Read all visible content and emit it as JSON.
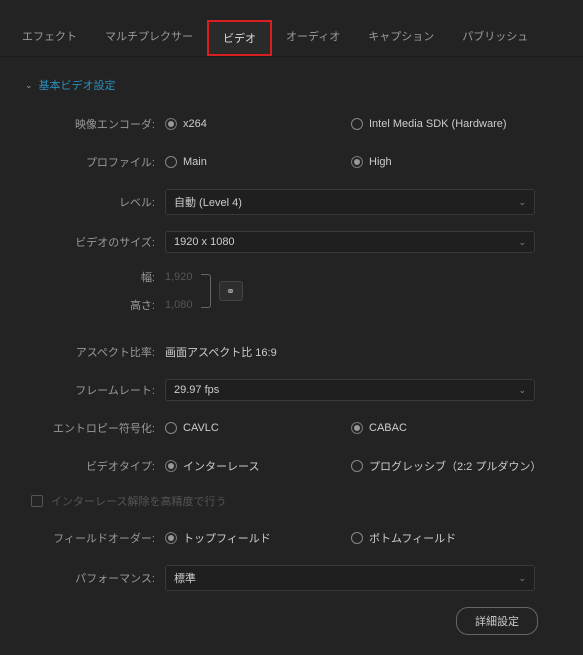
{
  "tabs": {
    "effect": "エフェクト",
    "multiplexer": "マルチプレクサー",
    "video": "ビデオ",
    "audio": "オーディオ",
    "caption": "キャプション",
    "publish": "パブリッシュ"
  },
  "section": {
    "title": "基本ビデオ設定"
  },
  "fields": {
    "encoder": {
      "label": "映像エンコーダ:",
      "opt1": "x264",
      "opt2": "Intel Media SDK (Hardware)"
    },
    "profile": {
      "label": "プロファイル:",
      "opt1": "Main",
      "opt2": "High"
    },
    "level": {
      "label": "レベル:",
      "value": "自動 (Level 4)"
    },
    "size": {
      "label": "ビデオのサイズ:",
      "value": "1920 x 1080"
    },
    "width": {
      "label": "幅:",
      "value": "1,920"
    },
    "height": {
      "label": "高さ:",
      "value": "1,080"
    },
    "aspect": {
      "label": "アスペクト比率:",
      "value": "画面アスペクト比 16:9"
    },
    "framerate": {
      "label": "フレームレート:",
      "value": "29.97 fps"
    },
    "entropy": {
      "label": "エントロピー符号化:",
      "opt1": "CAVLC",
      "opt2": "CABAC"
    },
    "videotype": {
      "label": "ビデオタイプ:",
      "opt1": "インターレース",
      "opt2": "プログレッシブ（2:2 プルダウン）"
    },
    "deinterlace": {
      "label": "インターレース解除を高精度で行う"
    },
    "fieldorder": {
      "label": "フィールドオーダー:",
      "opt1": "トップフィールド",
      "opt2": "ボトムフィールド"
    },
    "performance": {
      "label": "パフォーマンス:",
      "value": "標準"
    },
    "advanced": "詳細設定"
  }
}
